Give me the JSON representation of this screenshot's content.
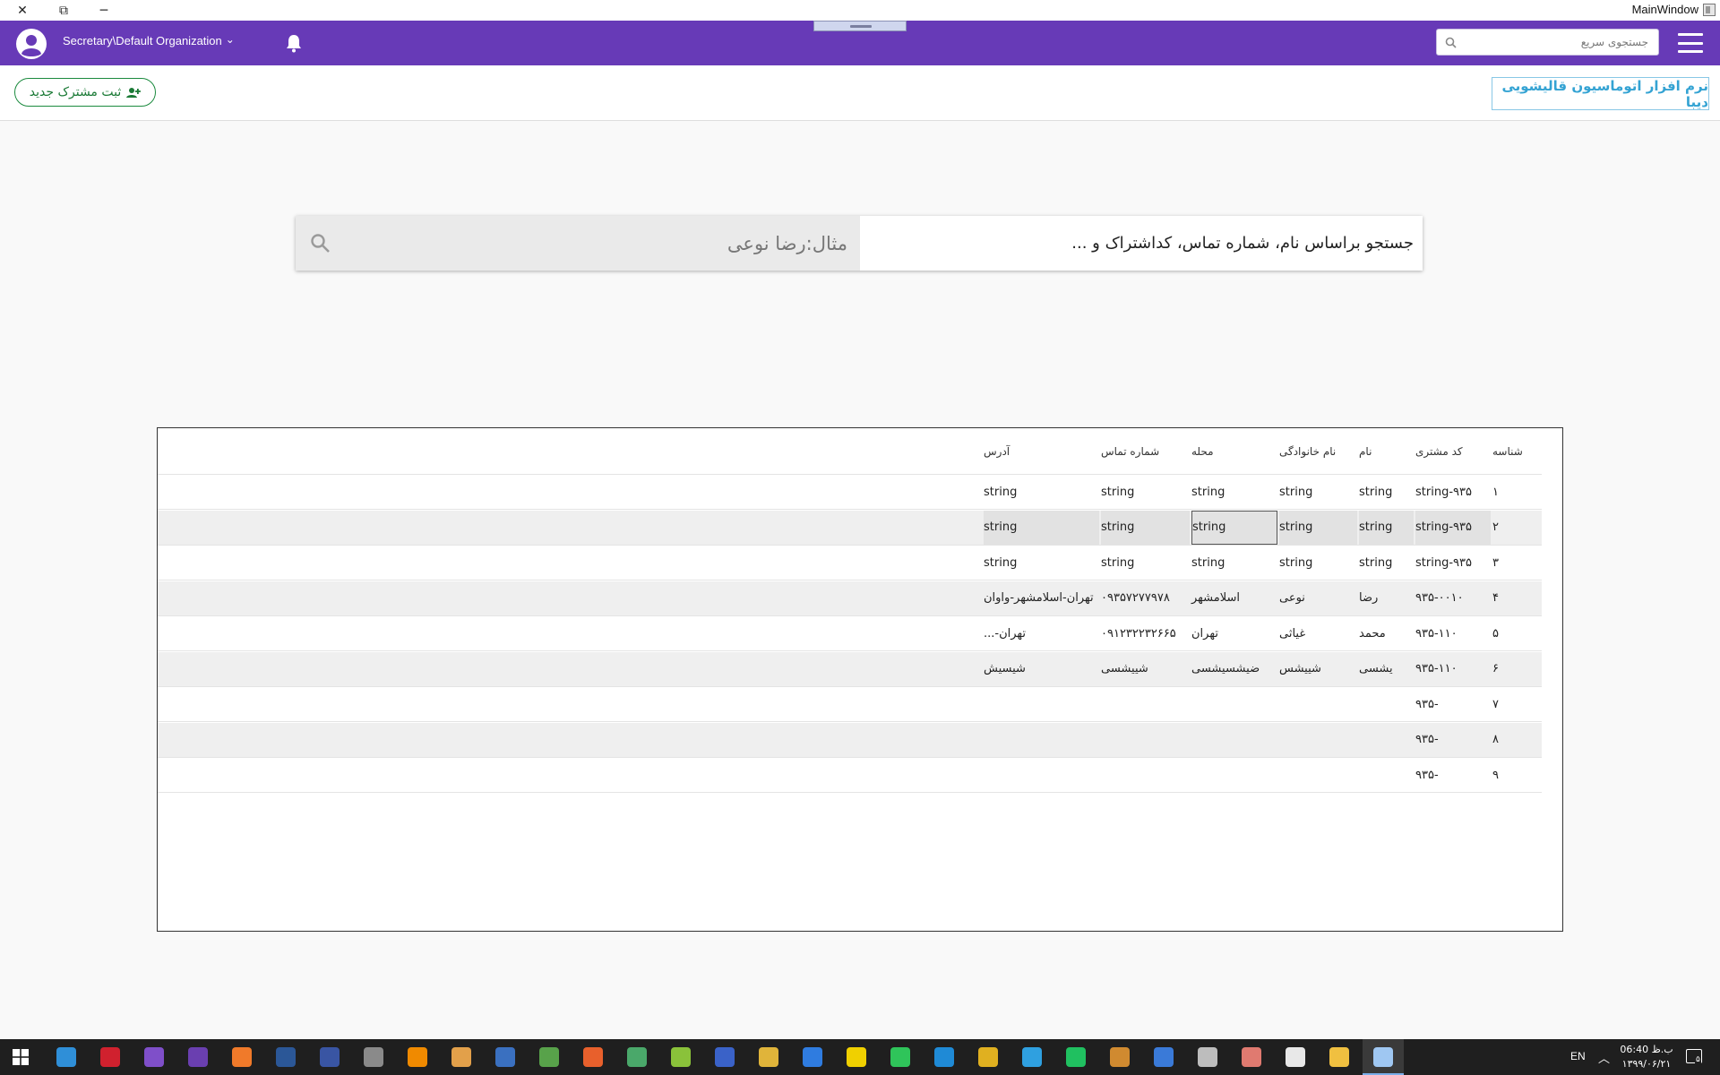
{
  "window": {
    "title": "MainWindow",
    "close_glyph": "✕",
    "restore_glyph": "⧉",
    "minimize_glyph": "─"
  },
  "appbar": {
    "org_name": "Secretary\\Default Organization",
    "dropdown_glyph": "⌄",
    "quick_search_placeholder": "جستجوی سریع",
    "color": "#673ab7"
  },
  "toolbar": {
    "new_customer_label": "ثبت مشترک جدید",
    "app_name": "نرم افزار اتوماسیون قالیشویی دیبا"
  },
  "search": {
    "label": "جستجو براساس نام، شماره تماس، کداشتراک و ...",
    "placeholder": "مثال:رضا نوعی"
  },
  "grid": {
    "columns": [
      "شناسه",
      "کد مشتری",
      "نام",
      "نام خانوادگی",
      "محله",
      "شماره تماس",
      "آدرس"
    ],
    "rows": [
      [
        "۱",
        "string-۹۳۵",
        "string",
        "string",
        "string",
        "string",
        "string"
      ],
      [
        "۲",
        "string-۹۳۵",
        "string",
        "string",
        "string",
        "string",
        "string"
      ],
      [
        "۳",
        "string-۹۳۵",
        "string",
        "string",
        "string",
        "string",
        "string"
      ],
      [
        "۴",
        "۹۳۵-۰۰۱۰",
        "رضا",
        "نوعی",
        "اسلامشهر",
        "۰۹۳۵۷۲۷۷۹۷۸",
        "تهران-اسلامشهر-واوان"
      ],
      [
        "۵",
        "۹۳۵-۱۱۰",
        "محمد",
        "غیاثی",
        "تهران",
        "۰۹۱۲۳۲۲۳۲۶۶۵",
        "تهران-..."
      ],
      [
        "۶",
        "۹۳۵-۱۱۰",
        "یشسی",
        "شییشس",
        "ضیشسیشسی",
        "شییشسی",
        "شیسیش"
      ],
      [
        "۷",
        "-۹۳۵",
        "",
        "",
        "",
        "",
        ""
      ],
      [
        "۸",
        "-۹۳۵",
        "",
        "",
        "",
        "",
        ""
      ],
      [
        "۹",
        "-۹۳۵",
        "",
        "",
        "",
        "",
        ""
      ]
    ]
  },
  "taskbar": {
    "language": "EN",
    "tray_arrow": "︿",
    "time": "06:40 ب.ظ",
    "date": "۱۳۹۹/۰۶/۲۱",
    "notification_count": "۵"
  }
}
